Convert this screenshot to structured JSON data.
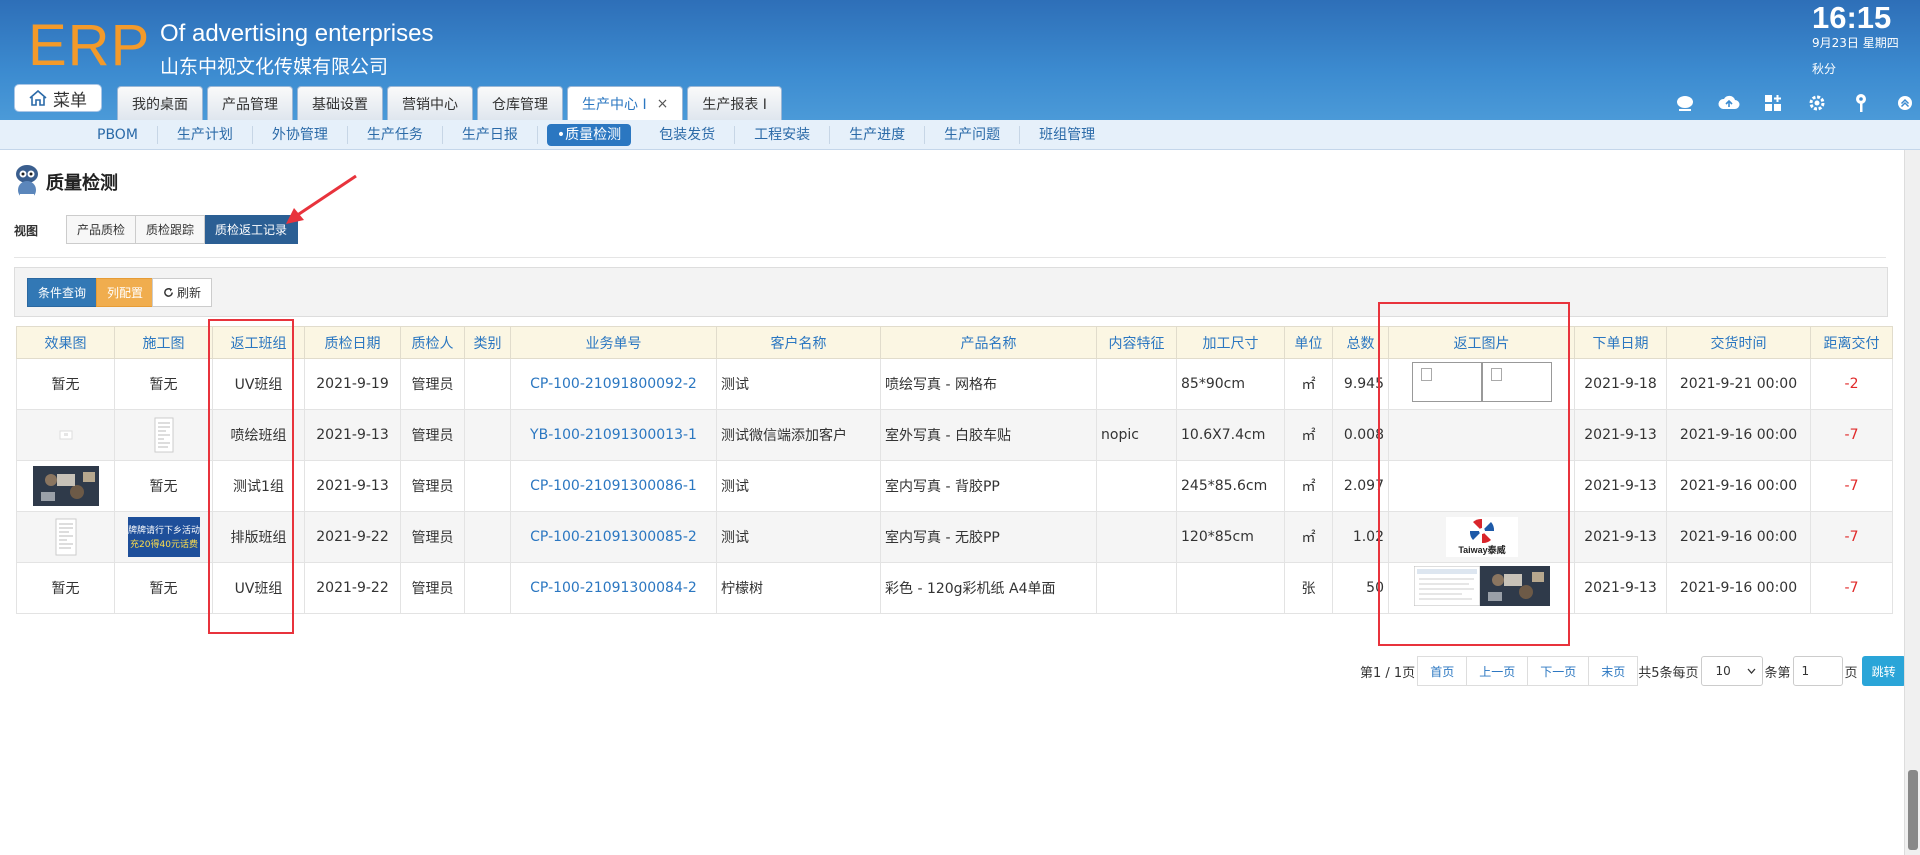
{
  "header": {
    "logo": "ERP",
    "company_en": "Of advertising enterprises",
    "company_cn": "山东中视文化传媒有限公司",
    "time": "16:15",
    "date": "9月23日 星期四",
    "season": "秋分",
    "menu_label": "菜单",
    "tabs": [
      {
        "label": "我的桌面"
      },
      {
        "label": "产品管理"
      },
      {
        "label": "基础设置"
      },
      {
        "label": "营销中心"
      },
      {
        "label": "仓库管理"
      },
      {
        "label": "生产中心 I",
        "active": true,
        "close": "×"
      },
      {
        "label": "生产报表 I"
      }
    ],
    "icons": [
      "chat-icon",
      "cloud-upload-icon",
      "grid-add-icon",
      "gear-icon",
      "key-icon",
      "collapse-icon"
    ]
  },
  "subnav": [
    "PBOM",
    "生产计划",
    "外协管理",
    "生产任务",
    "生产日报",
    "•质量检测",
    "包装发货",
    "工程安装",
    "生产进度",
    "生产问题",
    "班组管理"
  ],
  "page": {
    "title": "质量检测",
    "view_label": "视图",
    "views": [
      "产品质检",
      "质检跟踪",
      "质检返工记录"
    ]
  },
  "toolbar": {
    "query": "条件查询",
    "columns": "列配置",
    "refresh": "刷新"
  },
  "table": {
    "headers": [
      "效果图",
      "施工图",
      "返工班组",
      "质检日期",
      "质检人",
      "类别",
      "业务单号",
      "客户名称",
      "产品名称",
      "内容特征",
      "加工尺寸",
      "单位",
      "总数",
      "返工图片",
      "下单日期",
      "交货时间",
      "距离交付"
    ],
    "rows": [
      {
        "effect": "暂无",
        "construction": "暂无",
        "team": "UV班组",
        "qc_date": "2021-9-19",
        "inspector": "管理员",
        "category": "",
        "order_no": "CP-100-21091800092-2",
        "customer": "测试",
        "product": "喷绘写真 - 网格布",
        "feature": "",
        "size": "85*90cm",
        "unit": "㎡",
        "total": "9.945",
        "order_date": "2021-9-18",
        "delivery": "2021-9-21 00:00",
        "distance": "-2"
      },
      {
        "effect": "",
        "construction": "",
        "team": "喷绘班组",
        "qc_date": "2021-9-13",
        "inspector": "管理员",
        "category": "",
        "order_no": "YB-100-21091300013-1",
        "customer": "测试微信端添加客户",
        "product": "室外写真 - 白胶车贴",
        "feature": "nopic",
        "size": "10.6X7.4cm",
        "unit": "㎡",
        "total": "0.008",
        "order_date": "2021-9-13",
        "delivery": "2021-9-16 00:00",
        "distance": "-7"
      },
      {
        "effect": "",
        "construction": "暂无",
        "team": "测试1组",
        "qc_date": "2021-9-13",
        "inspector": "管理员",
        "category": "",
        "order_no": "CP-100-21091300086-1",
        "customer": "测试",
        "product": "室内写真 - 背胶PP",
        "feature": "",
        "size": "245*85.6cm",
        "unit": "㎡",
        "total": "2.097",
        "order_date": "2021-9-13",
        "delivery": "2021-9-16 00:00",
        "distance": "-7"
      },
      {
        "effect": "",
        "construction": "",
        "team": "排版班组",
        "qc_date": "2021-9-22",
        "inspector": "管理员",
        "category": "",
        "order_no": "CP-100-21091300085-2",
        "customer": "测试",
        "product": "室内写真 - 无胶PP",
        "feature": "",
        "size": "120*85cm",
        "unit": "㎡",
        "total": "1.02",
        "order_date": "2021-9-13",
        "delivery": "2021-9-16 00:00",
        "distance": "-7"
      },
      {
        "effect": "暂无",
        "construction": "暂无",
        "team": "UV班组",
        "qc_date": "2021-9-22",
        "inspector": "管理员",
        "category": "",
        "order_no": "CP-100-21091300084-2",
        "customer": "柠檬树",
        "product": "彩色 - 120g彩机纸 A4单面",
        "feature": "",
        "size": "",
        "unit": "张",
        "total": "50",
        "order_date": "2021-9-13",
        "delivery": "2021-9-16 00:00",
        "distance": "-7"
      }
    ],
    "banner_text_1": "牌牌请行下乡活动",
    "banner_text_2": "充20得40元话费",
    "taiway_logo": "Taiway泰威"
  },
  "pager": {
    "page_info": "第1 / 1页",
    "first": "首页",
    "prev": "上一页",
    "next": "下一页",
    "last": "末页",
    "total_prefix": "共5条每页",
    "page_size": "10",
    "goto_prefix": "条第",
    "goto_value": "1",
    "goto_suffix": "页",
    "go": "跳转"
  },
  "colors": {
    "header_blue": "#3c8bd0",
    "logo_orange": "#f39a2a",
    "link_blue": "#2b77c1",
    "negative_red": "#e02a2a",
    "highlight_red": "#e8333c"
  }
}
